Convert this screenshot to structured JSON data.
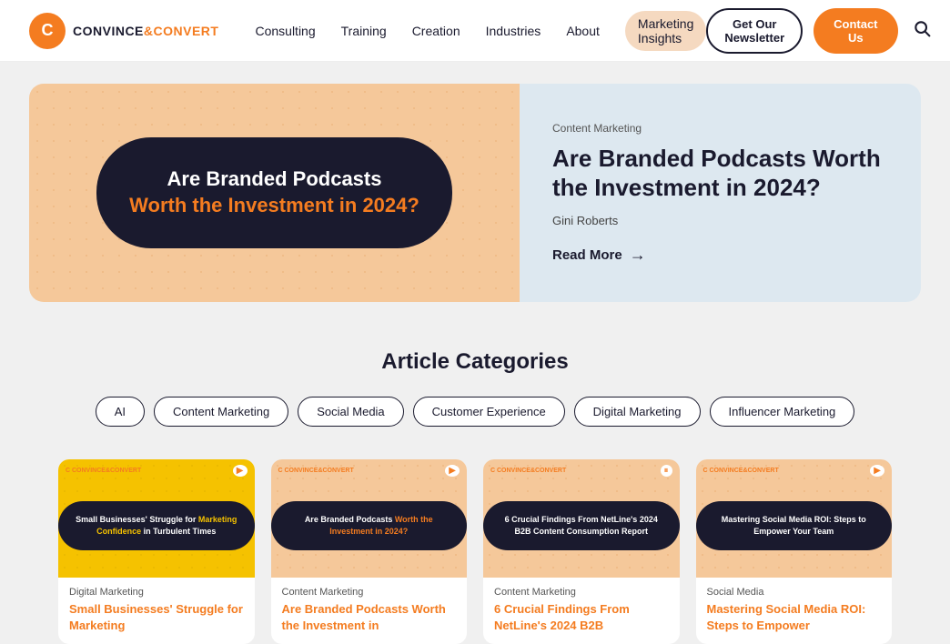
{
  "nav": {
    "logo_initial": "C",
    "logo_name1": "CONVINCE",
    "logo_name2": "&CONVERT",
    "links": [
      {
        "label": "Consulting",
        "active": false
      },
      {
        "label": "Training",
        "active": false
      },
      {
        "label": "Creation",
        "active": false
      },
      {
        "label": "Industries",
        "active": false
      },
      {
        "label": "About",
        "active": false
      },
      {
        "label": "Marketing Insights",
        "active": true
      }
    ],
    "newsletter_btn": "Get Our Newsletter",
    "contact_btn": "Contact Us"
  },
  "hero": {
    "category": "Content Marketing",
    "title": "Are Branded Podcasts Worth the Investment in 2024?",
    "author": "Gini Roberts",
    "read_more": "Read More",
    "image_title1": "Are Branded Podcasts",
    "image_title2": "Worth the Investment in 2024?"
  },
  "categories": {
    "title": "Article Categories",
    "items": [
      {
        "label": "AI"
      },
      {
        "label": "Content Marketing"
      },
      {
        "label": "Social Media"
      },
      {
        "label": "Customer Experience"
      },
      {
        "label": "Digital Marketing"
      },
      {
        "label": "Influencer Marketing"
      }
    ]
  },
  "articles": [
    {
      "category": "Digital Marketing",
      "title": "Small Businesses' Struggle for Marketing",
      "thumb_text1": "Small Businesses' Struggle for",
      "thumb_text2": "Marketing Confidence",
      "thumb_text3": "in Turbulent Times",
      "bg": "yellow",
      "share_icon": "▶"
    },
    {
      "category": "Content Marketing",
      "title": "Are Branded Podcasts Worth the Investment in",
      "thumb_text1": "Are Branded Podcasts",
      "thumb_text2": "Worth the Investment in 2024?",
      "bg": "orange",
      "share_icon": "▶"
    },
    {
      "category": "Content Marketing",
      "title": "6 Crucial Findings From NetLine's 2024 B2B",
      "thumb_text1": "6 Crucial Findings From",
      "thumb_text2": "NetLine's 2024 B2B Content Consumption",
      "thumb_text3": "Report",
      "bg": "orange",
      "share_icon": "⏸"
    },
    {
      "category": "Social Media",
      "title": "Mastering Social Media ROI: Steps to Empower",
      "thumb_text1": "Mastering Social Media ROI:",
      "thumb_text2": "Steps to Empower",
      "thumb_text3": "Your Team",
      "bg": "orange",
      "share_icon": "▶"
    }
  ]
}
